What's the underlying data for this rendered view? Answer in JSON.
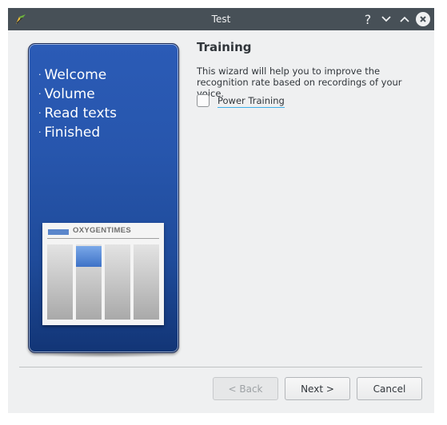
{
  "window": {
    "title": "Test"
  },
  "titlebar": {
    "app_icon": "kde-app-icon",
    "help_glyph": "?",
    "help_icon": "question-icon",
    "minimize_icon": "chevron-down-icon",
    "maximize_icon": "chevron-up-icon",
    "close_icon": "close-icon"
  },
  "sidebar": {
    "steps": [
      "Welcome",
      "Volume",
      "Read texts",
      "Finished"
    ],
    "newspaper_title": "OXYGENTIMES"
  },
  "page": {
    "title": "Training",
    "description": "This wizard will help you to improve the recognition rate based on recordings of your voice.",
    "checkbox_label": "Power Training",
    "checkbox_checked": false
  },
  "buttons": {
    "back": "< Back",
    "next": "Next >",
    "cancel": "Cancel"
  },
  "colors": {
    "titlebar": "#475057",
    "panel": "#2756ad",
    "accent": "#3daee9",
    "background": "#eff0f1"
  }
}
